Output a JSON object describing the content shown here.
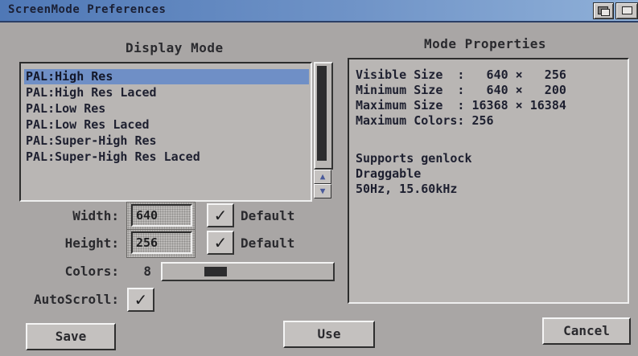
{
  "window": {
    "title": "ScreenMode Preferences"
  },
  "display_mode": {
    "heading": "Display Mode",
    "modes": [
      "PAL:High Res",
      "PAL:High Res Laced",
      "PAL:Low Res",
      "PAL:Low Res Laced",
      "PAL:Super-High Res",
      "PAL:Super-High Res Laced"
    ],
    "selected": "PAL:High Res",
    "scroll_up_icon": "▲",
    "scroll_down_icon": "▼"
  },
  "settings": {
    "width_label": "Width:",
    "width_value": "640",
    "width_default_label": "Default",
    "width_default_checked": true,
    "height_label": "Height:",
    "height_value": "256",
    "height_default_label": "Default",
    "height_default_checked": true,
    "colors_label": "Colors:",
    "colors_value": "8",
    "autoscroll_label": "AutoScroll:",
    "autoscroll_checked": true,
    "check_glyph": "✓"
  },
  "mode_properties": {
    "heading": "Mode Properties",
    "lines": [
      "Visible Size  :   640 ×   256",
      "Minimum Size  :   640 ×   200",
      "Maximum Size  : 16368 × 16384",
      "Maximum Colors: 256",
      "",
      "Supports genlock",
      "Draggable",
      "50Hz, 15.60kHz"
    ]
  },
  "buttons": {
    "save": "Save",
    "use": "Use",
    "cancel": "Cancel"
  },
  "colors": {
    "titlebar": "#5f86c0",
    "selection": "#6f8fc6",
    "panel": "#a9a6a5"
  }
}
